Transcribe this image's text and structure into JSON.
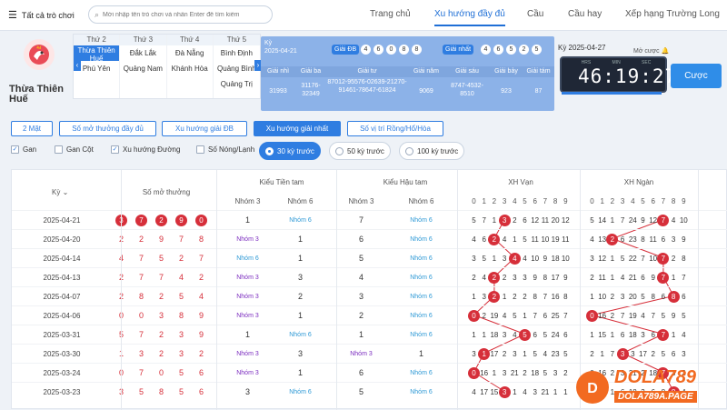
{
  "topbar": {
    "menu_label": "Tất cả trò chơi",
    "search_placeholder": "Mời nhập tên trò chơi và nhấn Enter để tìm kiếm",
    "tabs": [
      "Trang chủ",
      "Xu hướng đầy đủ",
      "Cầu",
      "Cầu hay",
      "Xếp hạng Trường Long"
    ],
    "active_tab": "Xu hướng đầy đủ"
  },
  "province": {
    "name": "Thừa Thiên Huế"
  },
  "days": [
    {
      "head": "Thứ 2",
      "items": [
        "Thừa Thiên Huế",
        "Phú Yên"
      ]
    },
    {
      "head": "Thứ 3",
      "items": [
        "Đắk Lắk",
        "Quảng Nam"
      ]
    },
    {
      "head": "Thứ 4",
      "items": [
        "Đà Nẵng",
        "Khánh Hòa"
      ]
    },
    {
      "head": "Thứ 5",
      "items": [
        "Bình Định",
        "Quảng Bình",
        "Quảng Trị"
      ]
    }
  ],
  "results": {
    "ky_label": "Kỳ",
    "date": "2025-04-21",
    "giai_db_label": "Giải ĐB",
    "giai_db_balls": [
      "4",
      "6",
      "0",
      "8",
      "8"
    ],
    "giai_nhat_label": "Giải nhất",
    "giai_nhat_balls": [
      "4",
      "6",
      "5",
      "2",
      "5"
    ],
    "headers": [
      "Giải nhì",
      "Giải ba",
      "Giải tư",
      "Giải năm",
      "Giải sáu",
      "Giải bảy",
      "Giải tám"
    ],
    "values": [
      "31993",
      "31176-32349",
      "87012-95576-02639-21270-91461-78647-61824",
      "9069",
      "8747-4532-8510",
      "923",
      "87"
    ]
  },
  "countdown": {
    "label": "Kỳ 2025-04-27",
    "mo_cuoc": "Mở cược",
    "units": [
      "HRS",
      "MIN",
      "SEC"
    ],
    "time": "46:19:27",
    "bet_button": "Cược"
  },
  "modes": [
    "2 Mặt",
    "Số mở thưởng đầy đủ",
    "Xu hướng giải ĐB",
    "Xu hướng giải nhất",
    "Số vị trí Rồng/Hổ/Hòa"
  ],
  "active_mode": "Xu hướng giải nhất",
  "checks": [
    {
      "label": "Gan",
      "checked": true
    },
    {
      "label": "Gan Cột",
      "checked": false
    },
    {
      "label": "Xu hướng Đường",
      "checked": true
    },
    {
      "label": "Số Nóng/Lạnh",
      "checked": false
    }
  ],
  "periods": [
    "30 kỳ trước",
    "50 kỳ trước",
    "100 kỳ trước"
  ],
  "active_period": "30 kỳ trước",
  "table": {
    "headers": {
      "ky": "Kỳ",
      "so_mo": "Số mở thưởng",
      "tien_tam": "Kiểu Tiền tam",
      "hau_tam": "Kiểu Hậu tam",
      "xh_van": "XH Vạn",
      "xh_ngan": "XH Ngàn",
      "nhom3": "Nhóm 3",
      "nhom6": "Nhóm 6",
      "digits": [
        "0",
        "1",
        "2",
        "3",
        "4",
        "5",
        "6",
        "7",
        "8",
        "9"
      ]
    },
    "rows": [
      {
        "date": "2025-04-21",
        "nums": [
          "3",
          "7",
          "2",
          "9",
          "0"
        ],
        "tt3": "1",
        "tt6": "Nhóm 6",
        "ht3": "7",
        "ht6": "Nhóm 6",
        "van": [
          "5",
          "7",
          "1",
          "3",
          "2",
          "6",
          "12",
          "11",
          "20",
          "12"
        ],
        "van_hit": 3,
        "ngan": [
          "5",
          "14",
          "1",
          "7",
          "24",
          "9",
          "12",
          "7",
          "4",
          "10"
        ],
        "ngan_hit": 7
      },
      {
        "date": "2025-04-20",
        "nums": [
          "2",
          "2",
          "9",
          "7",
          "8"
        ],
        "tt3": "Nhóm 3",
        "tt6": "1",
        "ht3": "6",
        "ht6": "Nhóm 6",
        "van": [
          "4",
          "6",
          "2",
          "4",
          "1",
          "5",
          "11",
          "10",
          "19",
          "11"
        ],
        "van_hit": 2,
        "ngan": [
          "4",
          "13",
          "2",
          "6",
          "23",
          "8",
          "11",
          "6",
          "3",
          "9"
        ],
        "ngan_hit": 2
      },
      {
        "date": "2025-04-14",
        "nums": [
          "4",
          "7",
          "5",
          "2",
          "7"
        ],
        "tt3": "Nhóm 6",
        "tt6": "1",
        "ht3": "5",
        "ht6": "Nhóm 6",
        "van": [
          "3",
          "5",
          "1",
          "3",
          "4",
          "4",
          "10",
          "9",
          "18",
          "10"
        ],
        "van_hit": 4,
        "ngan": [
          "3",
          "12",
          "1",
          "5",
          "22",
          "7",
          "10",
          "7",
          "2",
          "8"
        ],
        "ngan_hit": 7
      },
      {
        "date": "2025-04-13",
        "nums": [
          "2",
          "7",
          "7",
          "4",
          "2"
        ],
        "tt3": "Nhóm 3",
        "tt6": "3",
        "ht3": "4",
        "ht6": "Nhóm 6",
        "van": [
          "2",
          "4",
          "2",
          "2",
          "3",
          "3",
          "9",
          "8",
          "17",
          "9"
        ],
        "van_hit": 2,
        "ngan": [
          "2",
          "11",
          "1",
          "4",
          "21",
          "6",
          "9",
          "7",
          "1",
          "7"
        ],
        "ngan_hit": 7
      },
      {
        "date": "2025-04-07",
        "nums": [
          "2",
          "8",
          "2",
          "5",
          "4"
        ],
        "tt3": "Nhóm 3",
        "tt6": "2",
        "ht3": "3",
        "ht6": "Nhóm 6",
        "van": [
          "1",
          "3",
          "2",
          "1",
          "2",
          "2",
          "8",
          "7",
          "16",
          "8"
        ],
        "van_hit": 2,
        "ngan": [
          "1",
          "10",
          "2",
          "3",
          "20",
          "5",
          "8",
          "6",
          "8",
          "6"
        ],
        "ngan_hit": 8
      },
      {
        "date": "2025-04-06",
        "nums": [
          "0",
          "0",
          "3",
          "8",
          "9"
        ],
        "tt3": "Nhóm 3",
        "tt6": "1",
        "ht3": "2",
        "ht6": "Nhóm 6",
        "van": [
          "0",
          "2",
          "19",
          "4",
          "5",
          "1",
          "7",
          "6",
          "25",
          "7"
        ],
        "van_hit": 0,
        "ngan": [
          "0",
          "16",
          "2",
          "7",
          "19",
          "4",
          "7",
          "5",
          "9",
          "5"
        ],
        "ngan_hit": 0
      },
      {
        "date": "2025-03-31",
        "nums": [
          "5",
          "7",
          "2",
          "3",
          "9"
        ],
        "tt3": "1",
        "tt6": "Nhóm 6",
        "ht3": "1",
        "ht6": "Nhóm 6",
        "van": [
          "1",
          "1",
          "18",
          "3",
          "4",
          "5",
          "6",
          "5",
          "24",
          "6"
        ],
        "van_hit": 5,
        "ngan": [
          "1",
          "15",
          "1",
          "6",
          "18",
          "3",
          "6",
          "7",
          "1",
          "4"
        ],
        "ngan_hit": 7
      },
      {
        "date": "2025-03-30",
        "nums": [
          "1",
          "3",
          "2",
          "3",
          "2"
        ],
        "tt3": "Nhóm 3",
        "tt6": "3",
        "ht3": "Nhóm 3",
        "ht6": "1",
        "van": [
          "3",
          "1",
          "17",
          "2",
          "3",
          "1",
          "5",
          "4",
          "23",
          "5"
        ],
        "van_hit": 1,
        "ngan": [
          "2",
          "1",
          "7",
          "4",
          "3",
          "17",
          "2",
          "5",
          "6",
          "3"
        ],
        "ngan_hit": 3
      },
      {
        "date": "2025-03-24",
        "nums": [
          "0",
          "7",
          "0",
          "5",
          "6"
        ],
        "tt3": "Nhóm 3",
        "tt6": "1",
        "ht3": "6",
        "ht6": "Nhóm 6",
        "van": [
          "0",
          "16",
          "1",
          "3",
          "21",
          "2",
          "18",
          "5",
          "3",
          "2"
        ],
        "van_hit": 0,
        "ngan": [
          "0",
          "16",
          "2",
          "3",
          "21",
          "2",
          "18",
          "7",
          "3",
          "2"
        ],
        "ngan_hit": 7
      },
      {
        "date": "2025-03-23",
        "nums": [
          "3",
          "5",
          "8",
          "5",
          "6"
        ],
        "tt3": "3",
        "tt6": "Nhóm 6",
        "ht3": "5",
        "ht6": "Nhóm 6",
        "van": [
          "4",
          "17",
          "15",
          "3",
          "1",
          "4",
          "3",
          "21",
          "1",
          "1"
        ],
        "van_hit": 3,
        "ngan": [
          "1",
          "15",
          "1",
          "6",
          "18",
          "3",
          "6",
          "8",
          "1",
          "4"
        ],
        "ngan_hit": 8
      }
    ]
  },
  "watermark": {
    "brand": "DOLA789",
    "site": "DOLA789A.PAGE"
  },
  "colors": {
    "accent": "#2f7de1",
    "ball_red": "#d62f3a",
    "results_bg": "#8cb2e8"
  }
}
